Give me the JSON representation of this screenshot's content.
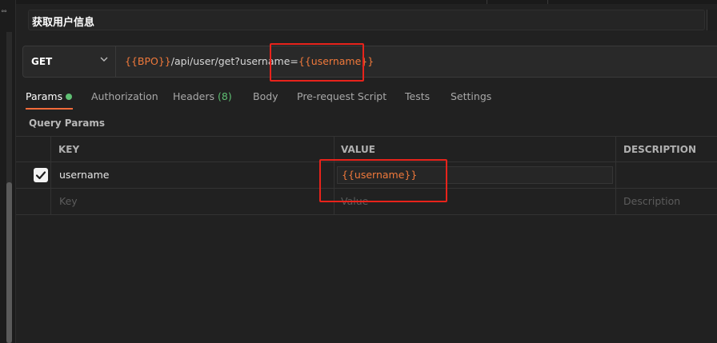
{
  "sidebar": {
    "dots": "°°"
  },
  "request": {
    "name": "获取用户信息",
    "method": "GET",
    "url_parts": {
      "base_var": "{{BPO}}",
      "path": "/api/user/get?username=",
      "param_var": "{{username}}"
    }
  },
  "tabs": {
    "params": "Params",
    "authorization": "Authorization",
    "headers": "Headers",
    "headers_count": "(8)",
    "body": "Body",
    "pre_request": "Pre-request Script",
    "tests": "Tests",
    "settings": "Settings"
  },
  "query_params": {
    "section_label": "Query Params",
    "columns": {
      "key": "KEY",
      "value": "VALUE",
      "description": "DESCRIPTION"
    },
    "rows": [
      {
        "checked": true,
        "key": "username",
        "value": "{{username}}",
        "description": ""
      }
    ],
    "placeholders": {
      "key": "Key",
      "value": "Value",
      "description": "Description"
    }
  },
  "colors": {
    "variable": "#f0793b",
    "active_tab_underline": "#f26b3a",
    "active_dot": "#5fbf73",
    "highlight_box": "#e8231b"
  }
}
